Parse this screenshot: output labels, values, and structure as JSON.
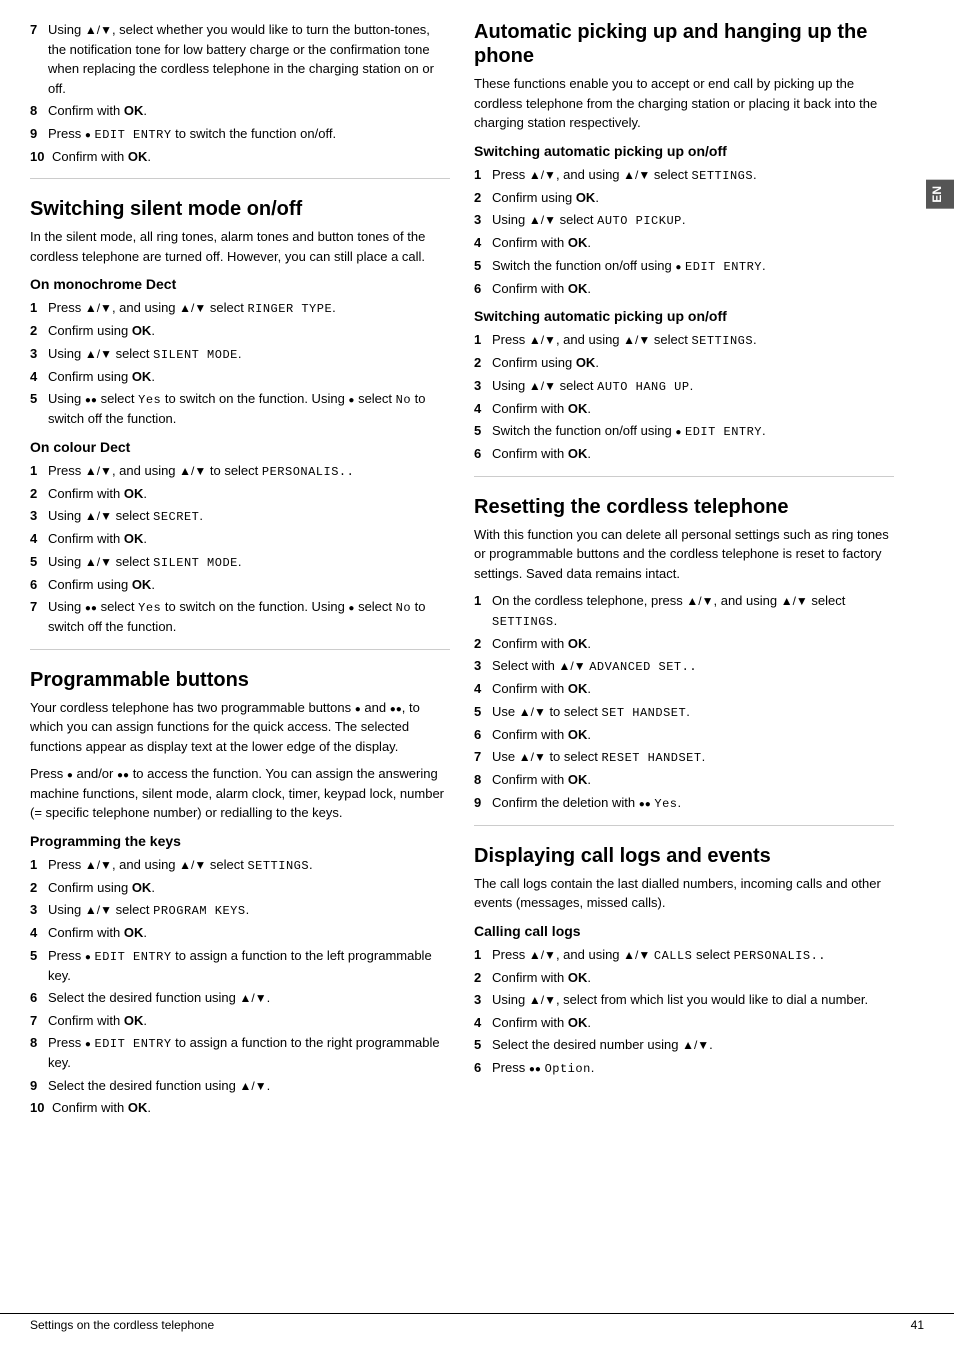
{
  "en_tab": "EN",
  "footer": {
    "left": "Settings on the cordless telephone",
    "right": "41"
  },
  "left": {
    "intro_steps": [
      {
        "num": "7",
        "text": "Using ▲/▼, select whether you would like to turn the button-tones, the notification tone for low battery charge or the confirmation tone when replacing the cordless telephone in the charging station on or off."
      },
      {
        "num": "8",
        "text": "Confirm with OK."
      },
      {
        "num": "9",
        "text": "Press ● EDIT ENTRY to switch the function on/off."
      },
      {
        "num": "10",
        "text": "Confirm with OK."
      }
    ],
    "silent_mode": {
      "title": "Switching silent mode on/off",
      "body": "In the silent mode, all ring tones, alarm tones and button tones of the cordless telephone are turned off. However, you can still place a call.",
      "mono_subsection": "On monochrome Dect",
      "mono_steps": [
        {
          "num": "1",
          "text": "Press ▲/▼, and using ▲/▼ select RINGER TYPE."
        },
        {
          "num": "2",
          "text": "Confirm using OK."
        },
        {
          "num": "3",
          "text": "Using ▲/▼ select SILENT MODE."
        },
        {
          "num": "4",
          "text": "Confirm using OK."
        },
        {
          "num": "5",
          "text": "Using ●● select Yes to switch on the function. Using ● select No to switch off the function."
        }
      ],
      "colour_subsection": "On colour Dect",
      "colour_steps": [
        {
          "num": "1",
          "text": "Press ▲/▼, and using ▲/▼ to select PERSONALIS.."
        },
        {
          "num": "2",
          "text": "Confirm with OK."
        },
        {
          "num": "3",
          "text": "Using ▲/▼ select SECRET."
        },
        {
          "num": "4",
          "text": "Confirm with OK."
        },
        {
          "num": "5",
          "text": "Using ▲/▼ select SILENT MODE."
        },
        {
          "num": "6",
          "text": "Confirm using OK."
        },
        {
          "num": "7",
          "text": "Using ●● select Yes to switch on the function. Using ● select No to switch off the function."
        }
      ]
    },
    "prog_buttons": {
      "title": "Programmable buttons",
      "body1": "Your cordless telephone has two programmable buttons ● and ●●, to which you can assign functions for the quick access. The selected functions appear as display text at the lower edge of the display.",
      "body2": "Press ● and/or ●● to access the function. You can assign the answering machine functions, silent mode, alarm clock, timer, keypad lock, number (= specific telephone number) or redialling to the keys.",
      "keys_subsection": "Programming the keys",
      "keys_steps": [
        {
          "num": "1",
          "text": "Press ▲/▼, and using ▲/▼ select SETTINGS."
        },
        {
          "num": "2",
          "text": "Confirm using OK."
        },
        {
          "num": "3",
          "text": "Using ▲/▼ select PROGRAM KEYS."
        },
        {
          "num": "4",
          "text": "Confirm with OK."
        },
        {
          "num": "5",
          "text": "Press ● EDIT ENTRY to assign a function to the left programmable key."
        },
        {
          "num": "6",
          "text": "Select the desired function using ▲/▼."
        },
        {
          "num": "7",
          "text": "Confirm with OK."
        },
        {
          "num": "8",
          "text": "Press ● EDIT ENTRY to assign a function to the right programmable key."
        },
        {
          "num": "9",
          "text": "Select the desired function using ▲/▼."
        },
        {
          "num": "10",
          "text": "Confirm with OK."
        }
      ]
    }
  },
  "right": {
    "auto_pickup": {
      "title": "Automatic picking up and hanging up the phone",
      "body": "These functions enable you to accept or end call by picking up the cordless telephone from the charging station or placing it back into the charging station respectively.",
      "switch_on_title": "Switching automatic picking up on/off",
      "switch_on_steps": [
        {
          "num": "1",
          "text": "Press ▲/▼, and using ▲/▼ select SETTINGS."
        },
        {
          "num": "2",
          "text": "Confirm using OK."
        },
        {
          "num": "3",
          "text": "Using ▲/▼ select AUTO PICKUP."
        },
        {
          "num": "4",
          "text": "Confirm with OK."
        },
        {
          "num": "5",
          "text": "Switch the function on/off using ● EDIT ENTRY."
        },
        {
          "num": "6",
          "text": "Confirm with OK."
        }
      ],
      "switch_off_title": "Switching automatic picking up on/off",
      "switch_off_steps": [
        {
          "num": "1",
          "text": "Press ▲/▼, and using ▲/▼ select SETTINGS."
        },
        {
          "num": "2",
          "text": "Confirm using OK."
        },
        {
          "num": "3",
          "text": "Using ▲/▼ select AUTO HANG UP."
        },
        {
          "num": "4",
          "text": "Confirm with OK."
        },
        {
          "num": "5",
          "text": "Switch the function on/off using ● EDIT ENTRY."
        },
        {
          "num": "6",
          "text": "Confirm with OK."
        }
      ]
    },
    "reset": {
      "title": "Resetting the cordless telephone",
      "body": "With this function you can delete all personal settings such as ring tones or programmable buttons and the cordless telephone is reset to factory settings. Saved data remains intact.",
      "steps": [
        {
          "num": "1",
          "text": "On the cordless telephone, press ▲/▼, and using ▲/▼ select SETTINGS."
        },
        {
          "num": "2",
          "text": "Confirm with OK."
        },
        {
          "num": "3",
          "text": "Select with ▲/▼ ADVANCED SET.."
        },
        {
          "num": "4",
          "text": "Confirm with OK."
        },
        {
          "num": "5",
          "text": "Use ▲/▼ to select SET HANDSET."
        },
        {
          "num": "6",
          "text": "Confirm with OK."
        },
        {
          "num": "7",
          "text": "Use ▲/▼ to select RESET HANDSET."
        },
        {
          "num": "8",
          "text": "Confirm with OK."
        },
        {
          "num": "9",
          "text": "Confirm the deletion with ●● Yes."
        }
      ]
    },
    "call_logs": {
      "title": "Displaying call logs and events",
      "body": "The call logs contain the last dialled numbers, incoming calls and other events (messages, missed calls).",
      "calling_title": "Calling call logs",
      "calling_steps": [
        {
          "num": "1",
          "text": "Press ▲/▼, and using ▲/▼ CALLS select PERSONALIS.."
        },
        {
          "num": "2",
          "text": "Confirm with OK."
        },
        {
          "num": "3",
          "text": "Using ▲/▼, select from which list you would like to dial a number."
        },
        {
          "num": "4",
          "text": "Confirm with OK."
        },
        {
          "num": "5",
          "text": "Select the desired number using ▲/▼."
        },
        {
          "num": "6",
          "text": "Press ●● Option."
        }
      ]
    }
  }
}
